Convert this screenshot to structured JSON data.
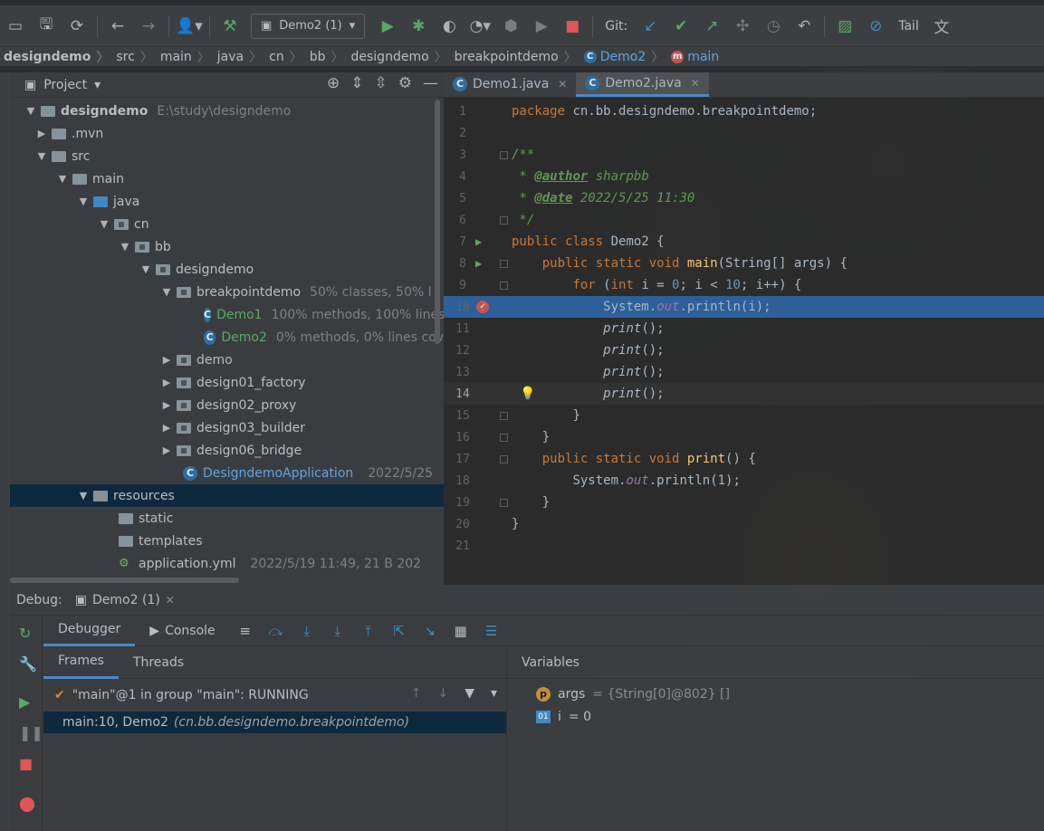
{
  "toolbar": {
    "run_config": "Demo2 (1)",
    "git_label": "Git:",
    "tail_label": "Tail"
  },
  "breadcrumb": [
    "designdemo",
    "src",
    "main",
    "java",
    "cn",
    "bb",
    "designdemo",
    "breakpointdemo",
    "Demo2",
    "main"
  ],
  "project": {
    "title": "Project",
    "tree": [
      {
        "label": "designdemo",
        "hint": "E:\\study\\designdemo"
      },
      {
        "label": ".mvn",
        "hint": ""
      },
      {
        "label": "src",
        "hint": ""
      },
      {
        "label": "main",
        "hint": ""
      },
      {
        "label": "java",
        "hint": ""
      },
      {
        "label": "cn",
        "hint": ""
      },
      {
        "label": "bb",
        "hint": ""
      },
      {
        "label": "designdemo",
        "hint": ""
      },
      {
        "label": "breakpointdemo",
        "hint": "50% classes, 50% l"
      },
      {
        "label": "Demo1",
        "hint": "100% methods, 100% lines"
      },
      {
        "label": "Demo2",
        "hint": "0% methods, 0% lines cov"
      },
      {
        "label": "demo",
        "hint": ""
      },
      {
        "label": "design01_factory",
        "hint": ""
      },
      {
        "label": "design02_proxy",
        "hint": ""
      },
      {
        "label": "design03_builder",
        "hint": ""
      },
      {
        "label": "design06_bridge",
        "hint": ""
      },
      {
        "label": "DesigndemoApplication",
        "hint": "2022/5/25"
      },
      {
        "label": "resources",
        "hint": ""
      },
      {
        "label": "static",
        "hint": ""
      },
      {
        "label": "templates",
        "hint": ""
      },
      {
        "label": "application.yml",
        "hint": "2022/5/19 11:49, 21 B 202"
      }
    ]
  },
  "editor": {
    "tabs": [
      "Demo1.java",
      "Demo2.java"
    ],
    "line_numbers": [
      "1",
      "2",
      "3",
      "4",
      "5",
      "6",
      "7",
      "8",
      "9",
      "10",
      "11",
      "12",
      "13",
      "14",
      "15",
      "16",
      "17",
      "18",
      "19",
      "20",
      "21"
    ],
    "code": {
      "l1_kw": "package",
      "l1_rest": " cn.bb.designdemo.breakpointdemo;",
      "l3": "/**",
      "l4_pre": " * ",
      "l4_tag": "@author",
      "l4_val": " sharpbb",
      "l5_pre": " * ",
      "l5_tag": "@date",
      "l5_val": " 2022/5/25 11:30",
      "l6": " */",
      "l7_kw": "public class",
      "l7_rest": " Demo2 {",
      "l8_kw": "public static void",
      "l8_fn": "main",
      "l8_rest": "(String[] args) {",
      "l9_kw": "for",
      "l9_a": " (",
      "l9_int": "int",
      "l9_b": " i = ",
      "l9_n0": "0",
      "l9_c": "; i < ",
      "l9_n10": "10",
      "l9_d": "; i++) {",
      "l10_a": "System.",
      "l10_out": "out",
      "l10_b": ".println(i);",
      "print_call": "print",
      "print_rest": "();",
      "brace_close": "}",
      "l17_kw": "public static void",
      "l17_fn": "print",
      "l17_rest": "() {",
      "l18_a": "System.",
      "l18_out": "out",
      "l18_b": ".println(1);"
    }
  },
  "debug": {
    "label": "Debug:",
    "session_tab": "Demo2 (1)",
    "subtabs": [
      "Debugger",
      "Console"
    ],
    "frames_tabs": [
      "Frames",
      "Threads"
    ],
    "thread": "\"main\"@1 in group \"main\": RUNNING",
    "frame_main": "main:10, Demo2",
    "frame_pkg": "(cn.bb.designdemo.breakpointdemo)",
    "variables_title": "Variables",
    "variables": [
      {
        "name": "args",
        "value": "= {String[0]@802} []"
      },
      {
        "name": "i",
        "value": "= 0"
      }
    ]
  }
}
